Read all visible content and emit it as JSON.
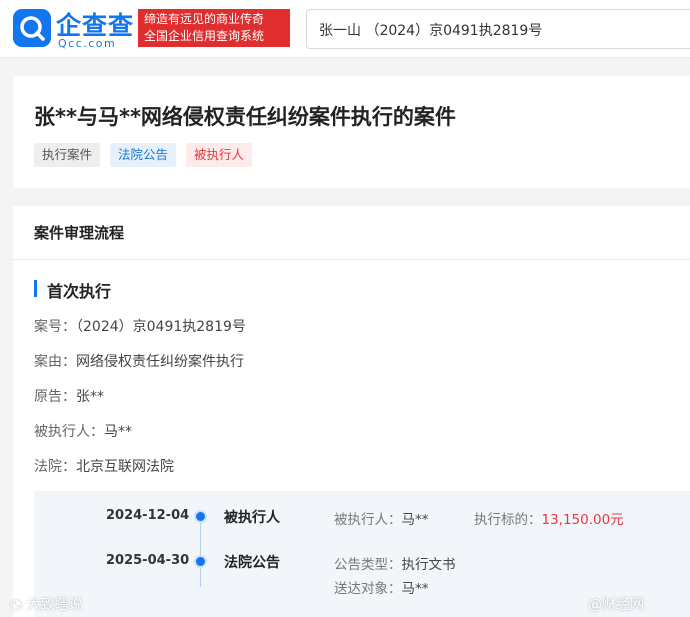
{
  "header": {
    "logo_cn": "企查查",
    "logo_en": "Qcc.com",
    "slogan_line1": "缔造有远见的商业传奇",
    "slogan_line2": "全国企业信用查询系统",
    "search_value": "张一山 （2024）京0491执2819号"
  },
  "case": {
    "title": "张**与马**网络侵权责任纠纷案件执行的案件",
    "tags": [
      "执行案件",
      "法院公告",
      "被执行人"
    ]
  },
  "process": {
    "section_title": "案件审理流程",
    "stage_title": "首次执行",
    "fields": [
      {
        "label": "案号：",
        "value": "（2024）京0491执2819号"
      },
      {
        "label": "案由：",
        "value": "网络侵权责任纠纷案件执行"
      },
      {
        "label": "原告：",
        "value": "张**"
      },
      {
        "label": "被执行人：",
        "value": "马**"
      },
      {
        "label": "法院：",
        "value": "北京互联网法院"
      }
    ],
    "timeline": [
      {
        "date": "2024-12-04",
        "type": "被执行人",
        "info1_label": "被执行人：",
        "info1_value": "马**",
        "info2_label": "执行标的：",
        "info2_value": "13,150.00元"
      },
      {
        "date": "2025-04-30",
        "type": "法院公告",
        "info1_label": "公告类型：",
        "info1_value": "执行文书",
        "info2_label": "送达对象：",
        "info2_value": "马**"
      }
    ]
  },
  "watermarks": {
    "left": "大致瞎说",
    "right": "@财经网"
  },
  "colors": {
    "brand_blue": "#1277ee",
    "slogan_red": "#e02d2d",
    "amount_red": "#e23b3b"
  }
}
